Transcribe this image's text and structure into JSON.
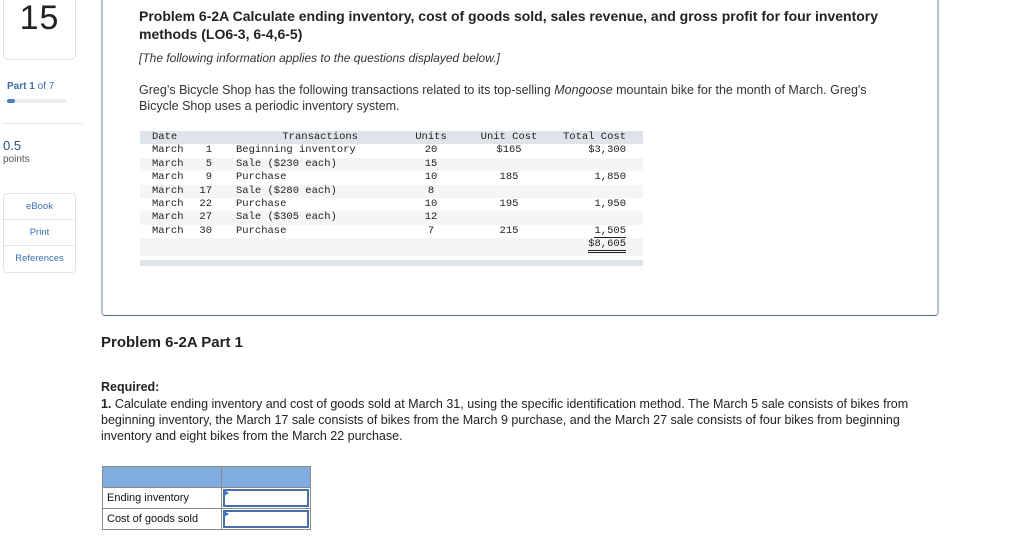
{
  "sidebar": {
    "question_number": "15",
    "part_prefix": "Part ",
    "part_current": "1",
    "part_suffix": " of 7",
    "progress_fraction": 0.142857,
    "points_value": "0.5",
    "points_label": "points",
    "links": [
      "eBook",
      "Print",
      "References"
    ]
  },
  "problem": {
    "title": "Problem 6-2A Calculate ending inventory, cost of goods sold, sales revenue, and gross profit for four inventory methods (LO6-3, 6-4,6-5)",
    "note": "[The following information applies to the questions displayed below.]",
    "intro_before": "Greg’s Bicycle Shop has the following transactions related to its top-selling ",
    "intro_italic": "Mongoose",
    "intro_after": " mountain bike for the month of March. Greg's Bicycle Shop uses a periodic inventory system."
  },
  "transactions": {
    "headers": {
      "date": "Date",
      "transactions": "Transactions",
      "units": "Units",
      "unit_cost": "Unit Cost",
      "total_cost": "Total Cost"
    },
    "rows": [
      {
        "month": "March",
        "day": "1",
        "desc": "Beginning inventory",
        "units": "20",
        "unit_cost": "$165",
        "total_cost": "$3,300"
      },
      {
        "month": "March",
        "day": "5",
        "desc": "Sale ($230 each)",
        "units": "15",
        "unit_cost": "",
        "total_cost": ""
      },
      {
        "month": "March",
        "day": "9",
        "desc": "Purchase",
        "units": "10",
        "unit_cost": "185",
        "total_cost": "1,850"
      },
      {
        "month": "March",
        "day": "17",
        "desc": "Sale ($280 each)",
        "units": "8",
        "unit_cost": "",
        "total_cost": ""
      },
      {
        "month": "March",
        "day": "22",
        "desc": "Purchase",
        "units": "10",
        "unit_cost": "195",
        "total_cost": "1,950"
      },
      {
        "month": "March",
        "day": "27",
        "desc": "Sale ($305 each)",
        "units": "12",
        "unit_cost": "",
        "total_cost": ""
      },
      {
        "month": "March",
        "day": "30",
        "desc": "Purchase",
        "units": "7",
        "unit_cost": "215",
        "total_cost": "1,505"
      }
    ],
    "total": "$8,605"
  },
  "part": {
    "title": "Problem 6-2A Part 1",
    "required_label": "Required:",
    "required_number": "1.",
    "required_text": " Calculate ending inventory and cost of goods sold at March 31, using the specific identification method. The March 5 sale consists of bikes from beginning inventory, the March 17 sale consists of bikes from the March 9 purchase, and the March 27 sale consists of four bikes from beginning inventory and eight bikes from the March 22 purchase."
  },
  "answer_table": {
    "rows": [
      {
        "label": "Ending inventory",
        "value": ""
      },
      {
        "label": "Cost of goods sold",
        "value": ""
      }
    ]
  }
}
